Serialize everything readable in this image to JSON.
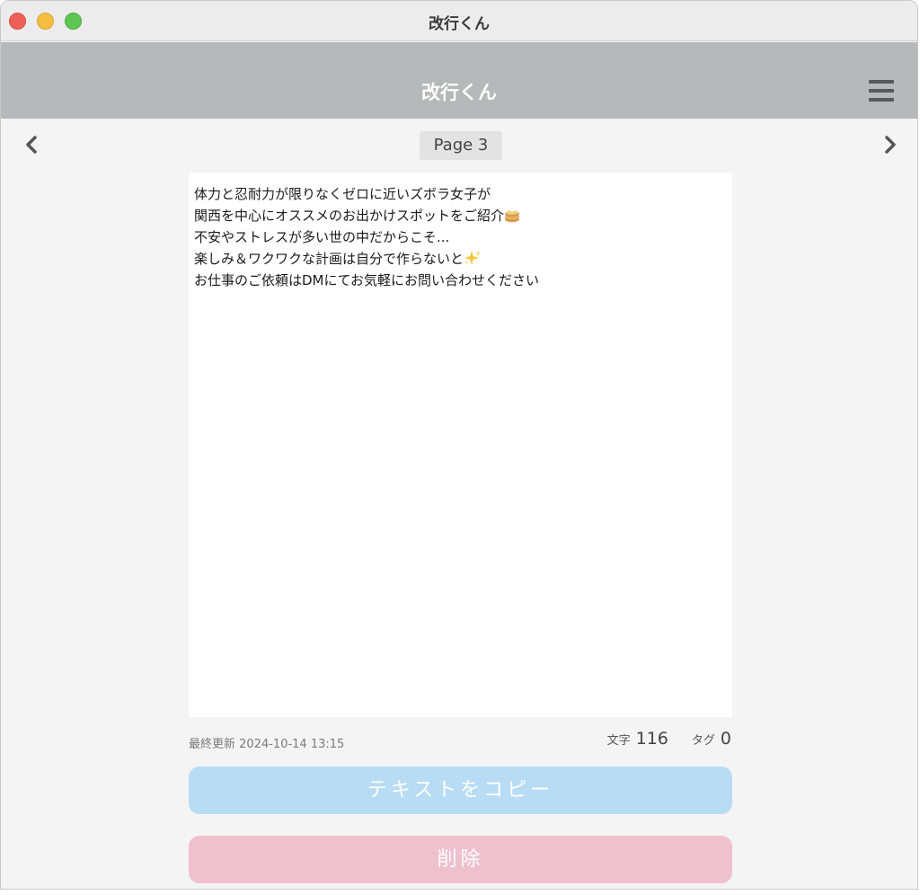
{
  "window": {
    "title": "改行くん"
  },
  "appbar": {
    "title": "改行くん",
    "menu_icon": "hamburger-menu-icon"
  },
  "pager": {
    "label": "Page 3",
    "prev_icon": "chevron-left-icon",
    "next_icon": "chevron-right-icon"
  },
  "editor": {
    "lines": [
      "体力と忍耐力が限りなくゼロに近いズボラ女子が",
      "関西を中心にオススメのお出かけスポットをご紹介",
      "不安やストレスが多い世の中だからこそ...",
      "楽しみ＆ワクワクな計画は自分で作らないと",
      "お仕事のご依頼はDMにてお気軽にお問い合わせください"
    ],
    "emoji": {
      "line2": "pancake-emoji",
      "line4": "sparkles-emoji"
    }
  },
  "meta": {
    "last_updated_label": "最終更新",
    "last_updated_value": "2024-10-14 13:15",
    "chars_label": "文字",
    "chars_value": "116",
    "tags_label": "タグ",
    "tags_value": "0"
  },
  "buttons": {
    "copy_label": "テキストをコピー",
    "delete_label": "削除"
  },
  "colors": {
    "appbar": "#b6b9ba",
    "copy_button": "#b8dcf4",
    "delete_button": "#efc1cc"
  }
}
